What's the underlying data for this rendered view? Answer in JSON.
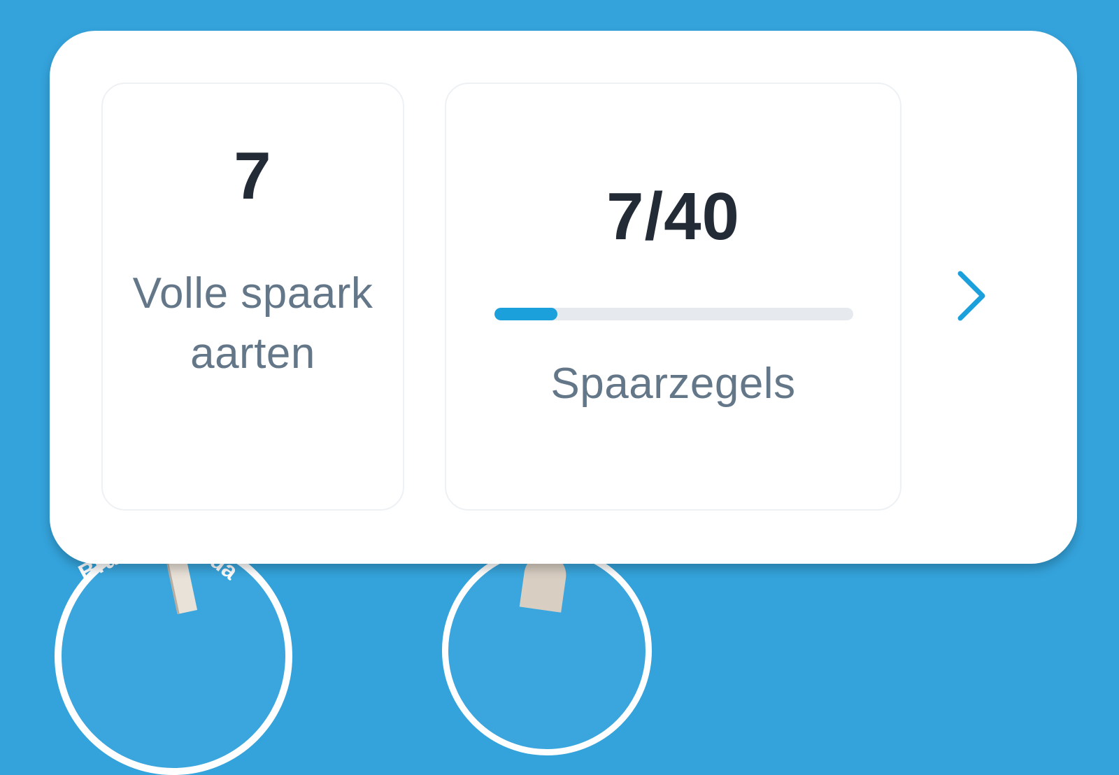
{
  "savings": {
    "full_cards": {
      "value": "7",
      "label": "Volle spaarkaarten"
    },
    "stamps": {
      "value": "7/40",
      "current": 7,
      "target": 40,
      "progress_fraction": 0.175,
      "label": "Spaarzegels"
    },
    "next_icon": "chevron-right-icon"
  },
  "background": {
    "badge_text_left": "Bra",
    "badge_text_right": "da"
  },
  "colors": {
    "background": "#34a3db",
    "card": "#ffffff",
    "accent": "#1ba0dc",
    "number_text": "#222b36",
    "label_text": "#637789",
    "progress_track": "#e6e9ee"
  }
}
